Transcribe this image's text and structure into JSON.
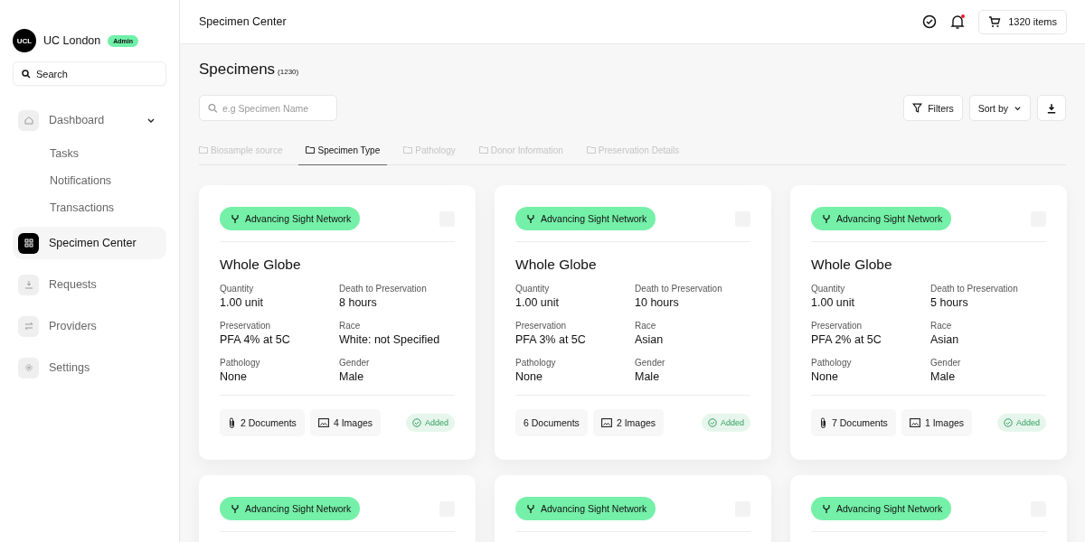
{
  "org": {
    "logo": "UCL",
    "name": "UC London",
    "badge": "Admin"
  },
  "sidebar": {
    "search_placeholder": "Search",
    "items": [
      {
        "label": "Dashboard",
        "selected": false,
        "expanded": true,
        "children": [
          {
            "label": "Tasks"
          },
          {
            "label": "Notifications"
          },
          {
            "label": "Transactions"
          }
        ]
      },
      {
        "label": "Specimen Center",
        "selected": true
      },
      {
        "label": "Requests",
        "selected": false
      },
      {
        "label": "Providers",
        "selected": false
      },
      {
        "label": "Settings",
        "selected": false
      }
    ]
  },
  "header": {
    "title": "Specimen Center",
    "notification_unread": true,
    "cart": "1320 items"
  },
  "page": {
    "title": "Specimens",
    "count": "(1230)",
    "search_placeholder": "e.g Specimen Name",
    "filters": "Filters",
    "sort": "Sort by"
  },
  "tabs": [
    {
      "label": "Biosample source",
      "selected": false
    },
    {
      "label": "Specimen Type",
      "selected": true
    },
    {
      "label": "Pathology",
      "selected": false
    },
    {
      "label": "Donor Information",
      "selected": false
    },
    {
      "label": "Preservation Details",
      "selected": false
    }
  ],
  "cards": [
    {
      "tag": "Advancing Sight Network",
      "checked": false,
      "title": "Whole Globe",
      "fields": [
        {
          "label": "Quantity",
          "value": "1.00 unit"
        },
        {
          "label": "Death to Preservation",
          "value": "8 hours"
        },
        {
          "label": "Preservation",
          "value": "PFA 4% at 5C"
        },
        {
          "label": "Race",
          "value": "White: not Specified"
        },
        {
          "label": "Pathology",
          "value": "None"
        },
        {
          "label": "Gender",
          "value": "Male"
        }
      ],
      "documents": "2 Documents",
      "documents_icon": true,
      "images": "4 Images",
      "status": "Added"
    },
    {
      "tag": "Advancing Sight Network",
      "checked": false,
      "title": "Whole Globe",
      "fields": [
        {
          "label": "Quantity",
          "value": "1.00 unit"
        },
        {
          "label": "Death to Preservation",
          "value": "10 hours"
        },
        {
          "label": "Preservation",
          "value": "PFA 3% at 5C"
        },
        {
          "label": "Race",
          "value": "Asian"
        },
        {
          "label": "Pathology",
          "value": "None"
        },
        {
          "label": "Gender",
          "value": "Male"
        }
      ],
      "documents": "6 Documents",
      "documents_icon": false,
      "images": "2 Images",
      "status": "Added"
    },
    {
      "tag": "Advancing Sight Network",
      "checked": false,
      "title": "Whole Globe",
      "fields": [
        {
          "label": "Quantity",
          "value": "1.00 unit"
        },
        {
          "label": "Death to Preservation",
          "value": "5 hours"
        },
        {
          "label": "Preservation",
          "value": "PFA 2% at 5C"
        },
        {
          "label": "Race",
          "value": "Asian"
        },
        {
          "label": "Pathology",
          "value": "None"
        },
        {
          "label": "Gender",
          "value": "Male"
        }
      ],
      "documents": "7 Documents",
      "documents_icon": true,
      "images": "1 Images",
      "status": "Added"
    },
    {
      "tag": "Advancing Sight Network",
      "checked": false
    },
    {
      "tag": "Advancing Sight Network",
      "checked": false
    },
    {
      "tag": "Advancing Sight Network",
      "checked": false
    }
  ]
}
